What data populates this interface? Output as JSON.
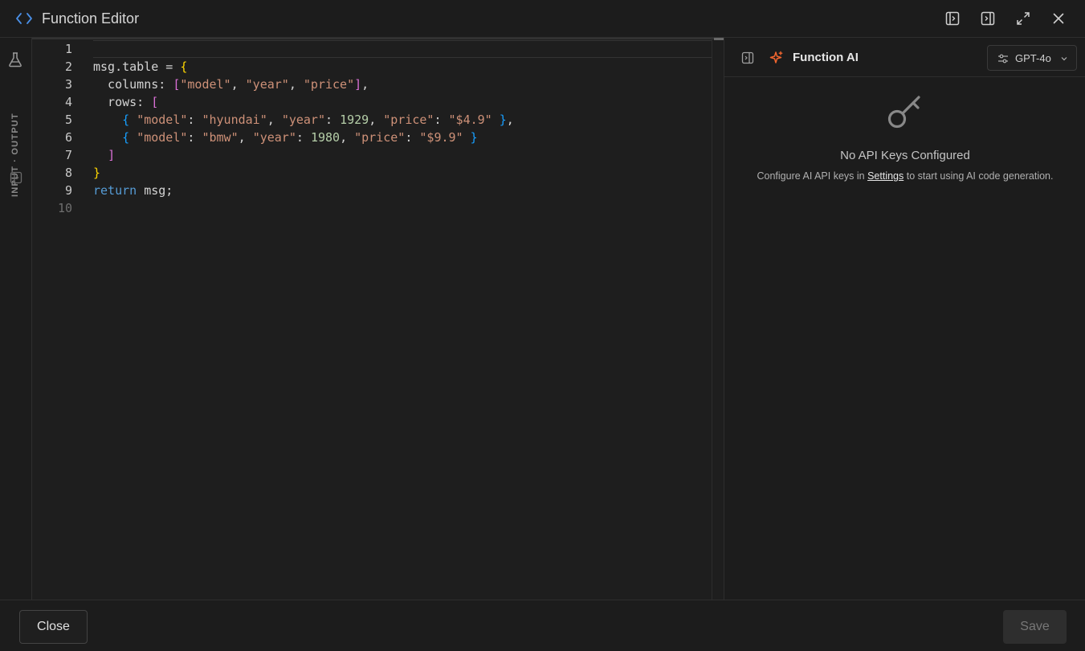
{
  "header": {
    "title": "Function Editor",
    "icons": [
      "code-icon",
      "panel-left-icon",
      "panel-right-icon",
      "expand-icon",
      "close-icon"
    ]
  },
  "leftbar": {
    "vertical_label": "INPUT · OUTPUT",
    "icons": [
      "flask-icon",
      "panel-toggle-icon"
    ]
  },
  "editor": {
    "line_numbers": [
      "1",
      "2",
      "3",
      "4",
      "5",
      "6",
      "7",
      "8",
      "9",
      "10"
    ],
    "code_lines": [
      "",
      "msg.table = {",
      "  columns: [\"model\", \"year\", \"price\"],",
      "  rows: [",
      "    { \"model\": \"hyundai\", \"year\": 1929, \"price\": \"$4.9\" },",
      "    { \"model\": \"bmw\", \"year\": 1980, \"price\": \"$9.9\" }",
      "  ]",
      "}",
      "return msg;",
      ""
    ],
    "theme_colors": {
      "keyword": "#569cd6",
      "string": "#ce9178",
      "number": "#b5cea8",
      "bracket1": "#ffd700",
      "bracket2": "#da70d6",
      "bracket3": "#179fff"
    }
  },
  "ai_panel": {
    "title": "Function AI",
    "model": "GPT-4o",
    "empty_title": "No API Keys Configured",
    "empty_desc_prefix": "Configure AI API keys in ",
    "empty_desc_link": "Settings",
    "empty_desc_suffix": " to start using AI code generation.",
    "accent_color": "#f0652f"
  },
  "footer": {
    "close_label": "Close",
    "save_label": "Save"
  }
}
